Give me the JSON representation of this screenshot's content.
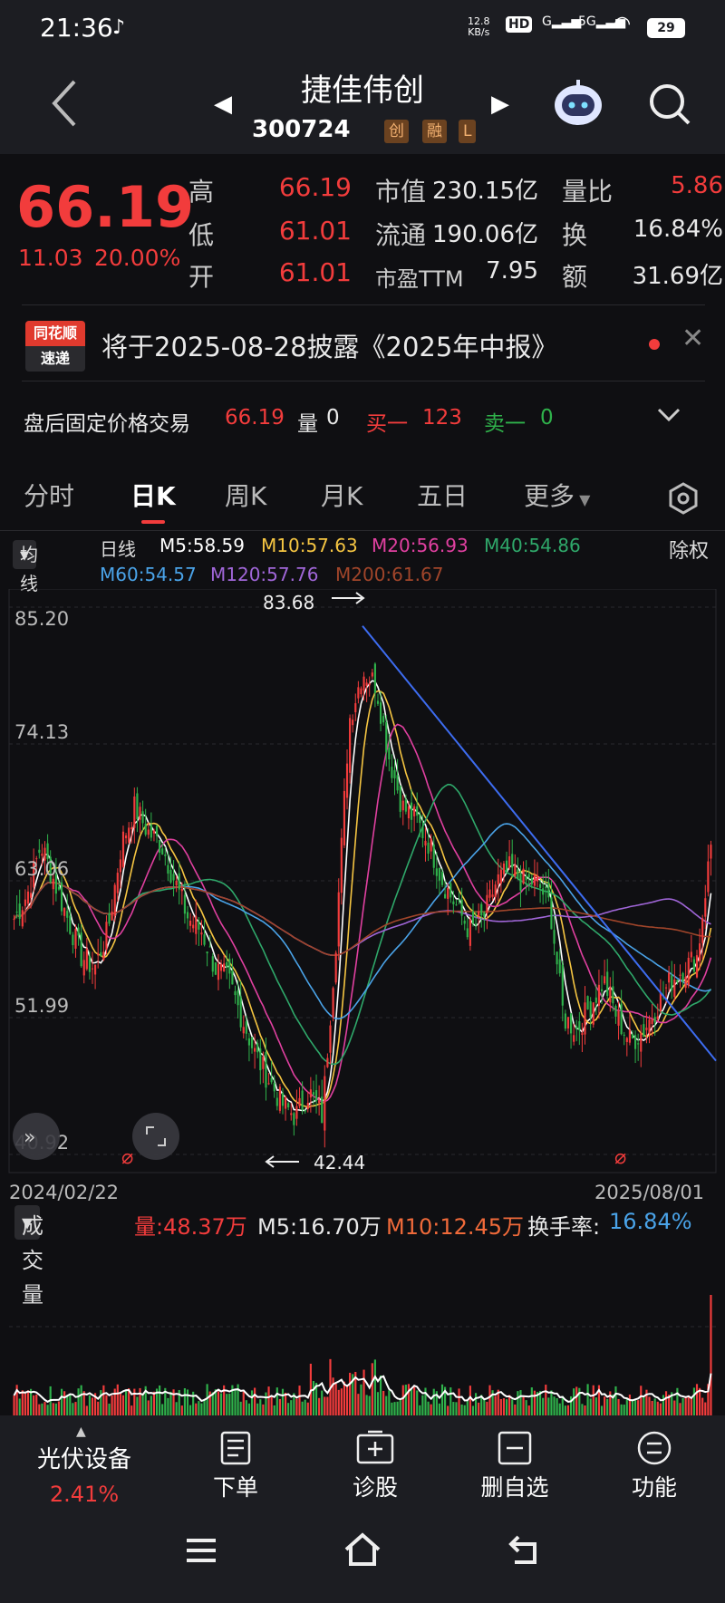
{
  "status_bar": {
    "time": "21:36",
    "net_speed": "12.8",
    "net_unit": "KB/s",
    "hd": "HD",
    "signal_1": "G",
    "signal_2": "5G",
    "battery": "29"
  },
  "header": {
    "stock_name": "捷佳伟创",
    "stock_code": "300724",
    "tags": [
      "创",
      "融",
      "L"
    ]
  },
  "quote": {
    "price": "66.19",
    "change": "11.03",
    "change_pct": "20.00%",
    "rows": [
      {
        "label": "高",
        "value": "66.19",
        "label2": "市值",
        "value2": "230.15亿",
        "label3": "量比",
        "value3": "5.86"
      },
      {
        "label": "低",
        "value": "61.01",
        "label2": "流通",
        "value2": "190.06亿",
        "label3": "换",
        "value3": "16.84%"
      },
      {
        "label": "开",
        "value": "61.01",
        "label2": "市盈TTM",
        "value2": "7.95",
        "label3": "额",
        "value3": "31.69亿"
      }
    ]
  },
  "notice": {
    "badge_top": "同花顺",
    "badge_bottom": "速递",
    "text": "将于2025-08-28披露《2025年中报》"
  },
  "after_hours": {
    "label": "盘后固定价格交易",
    "price": "66.19",
    "vol_label": "量",
    "vol": "0",
    "buy_label": "买一",
    "buy": "123",
    "sell_label": "卖一",
    "sell": "0"
  },
  "period_tabs": [
    "分时",
    "日K",
    "周K",
    "月K",
    "五日",
    "更多"
  ],
  "ma_legend": {
    "selector": "均线",
    "period": "日线",
    "fuquan": "除权",
    "items": [
      {
        "text": "M5:58.59",
        "color": "#ffffff"
      },
      {
        "text": "M10:57.63",
        "color": "#f5c542"
      },
      {
        "text": "M20:56.93",
        "color": "#e040a0"
      },
      {
        "text": "M40:54.86",
        "color": "#2fa86a"
      },
      {
        "text": "M60:54.57",
        "color": "#4aa3e8"
      },
      {
        "text": "M120:57.76",
        "color": "#a066d8"
      },
      {
        "text": "M200:61.67",
        "color": "#a0452a"
      }
    ]
  },
  "chart_data": {
    "type": "candlestick",
    "y_ticks": [
      "85.20",
      "74.13",
      "63.06",
      "51.99",
      "40.92"
    ],
    "ylim": [
      40.92,
      85.2
    ],
    "x_start": "2024/02/22",
    "x_end": "2025/08/01",
    "high_label": "83.68",
    "low_label": "42.44",
    "close_series": [
      60,
      62,
      66,
      63,
      60,
      57,
      56,
      59,
      66,
      69,
      67,
      66,
      63,
      60,
      59,
      56,
      55,
      52,
      49,
      47,
      45,
      44,
      46,
      44,
      58,
      76,
      80,
      79,
      73,
      69,
      68,
      66,
      63,
      61,
      59,
      60,
      63,
      64,
      63,
      63,
      61,
      52,
      51,
      53,
      55,
      52,
      50,
      51,
      53,
      55,
      56,
      57,
      66
    ]
  },
  "volume": {
    "selector": "成交量",
    "vol": "量:48.37万",
    "m5": "M5:16.70万",
    "m10": "M10:12.45万",
    "turnover_label": "换手率:",
    "turnover": "16.84%"
  },
  "bottom_bar": {
    "sector_name": "光伏设备",
    "sector_pct": "2.41%",
    "actions": [
      "下单",
      "诊股",
      "删自选",
      "功能"
    ]
  }
}
